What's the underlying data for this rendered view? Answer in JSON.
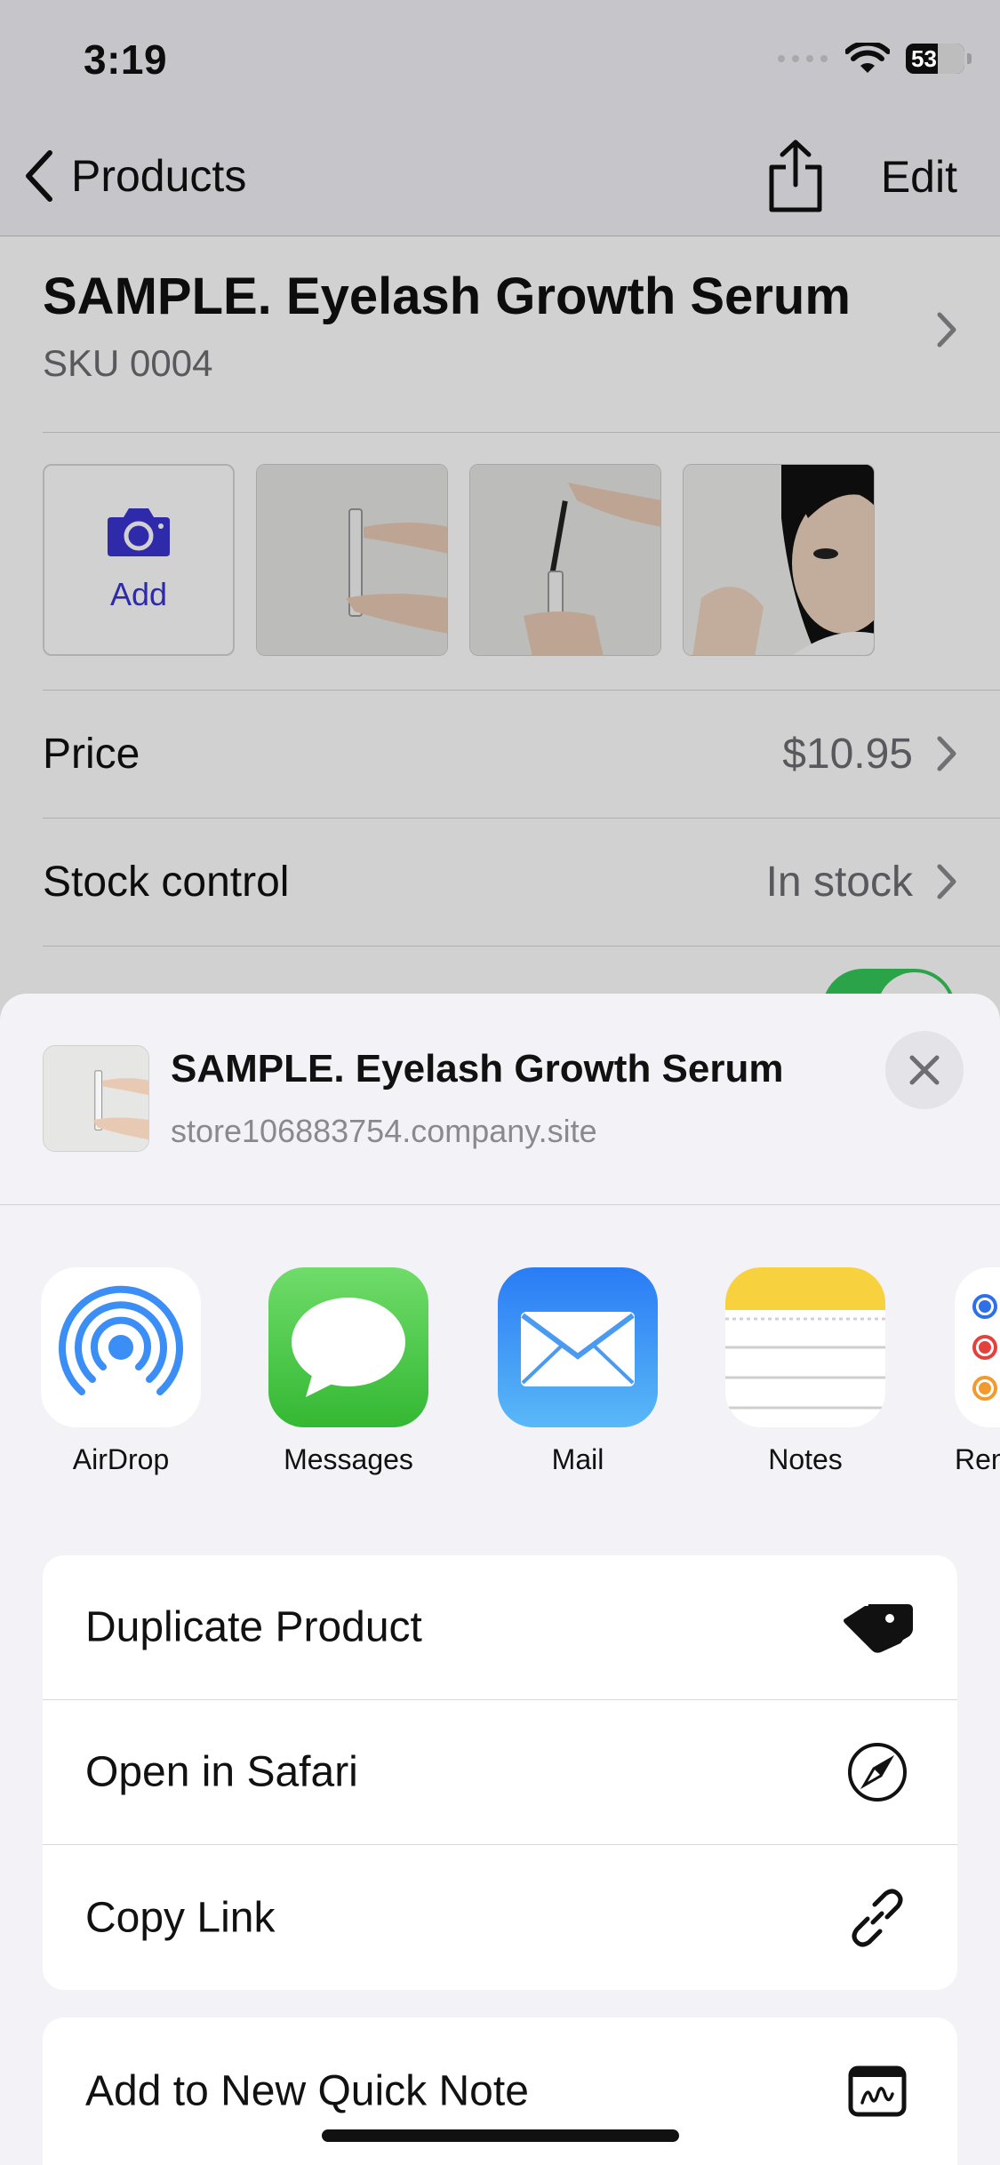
{
  "status": {
    "time": "3:19",
    "battery": "53"
  },
  "nav": {
    "back_label": "Products",
    "edit_label": "Edit"
  },
  "product": {
    "title": "SAMPLE. Eyelash Growth Serum",
    "sku": "SKU 0004",
    "add_photo_label": "Add",
    "price_label": "Price",
    "price_value": "$10.95",
    "stock_label": "Stock control",
    "stock_value": "In stock",
    "availability_enabled": true
  },
  "share_sheet": {
    "title": "SAMPLE. Eyelash Growth Serum",
    "subtitle": "store106883754.company.site",
    "apps": [
      {
        "label": "AirDrop",
        "icon": "airdrop-icon"
      },
      {
        "label": "Messages",
        "icon": "messages-icon"
      },
      {
        "label": "Mail",
        "icon": "mail-icon"
      },
      {
        "label": "Notes",
        "icon": "notes-icon"
      },
      {
        "label": "Rem",
        "icon": "reminders-icon"
      }
    ],
    "actions": [
      {
        "label": "Duplicate Product",
        "icon": "tags-icon"
      },
      {
        "label": "Open in Safari",
        "icon": "compass-icon"
      },
      {
        "label": "Copy Link",
        "icon": "link-icon"
      }
    ],
    "actions2": [
      {
        "label": "Add to New Quick Note",
        "icon": "quick-note-icon"
      }
    ]
  },
  "colors": {
    "accent": "#3a34cf",
    "toggle_on": "#34c759",
    "sheet_bg": "#f2f2f7"
  }
}
